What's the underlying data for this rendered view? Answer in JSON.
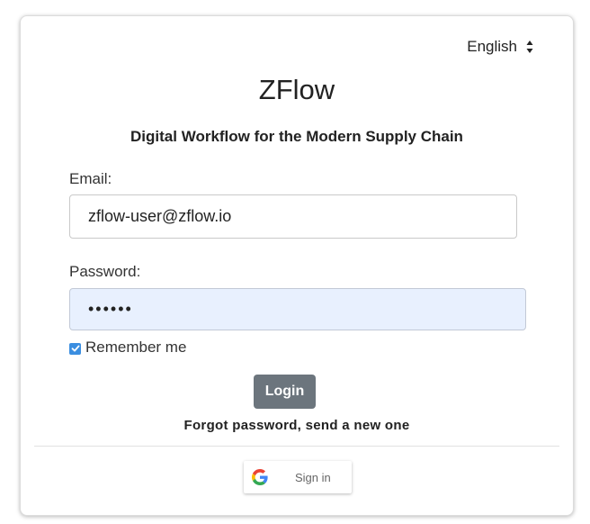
{
  "language_selector": {
    "selected": "English",
    "icon": "sort-arrows-icon"
  },
  "header": {
    "title": "ZFlow",
    "subtitle": "Digital Workflow for the Modern Supply Chain"
  },
  "form": {
    "email_label": "Email:",
    "email_value": "zflow-user@zflow.io",
    "password_label": "Password:",
    "password_value": "••••••",
    "remember_label": "Remember me",
    "remember_checked": true,
    "login_label": "Login",
    "forgot_label": "Forgot password, send a new one"
  },
  "google_signin": {
    "label": "Sign in",
    "icon": "google-g-icon"
  },
  "colors": {
    "login_button_bg": "#6c757d",
    "checkbox_accent": "#3b8ee0",
    "autofill_bg": "#e8f0fe"
  }
}
